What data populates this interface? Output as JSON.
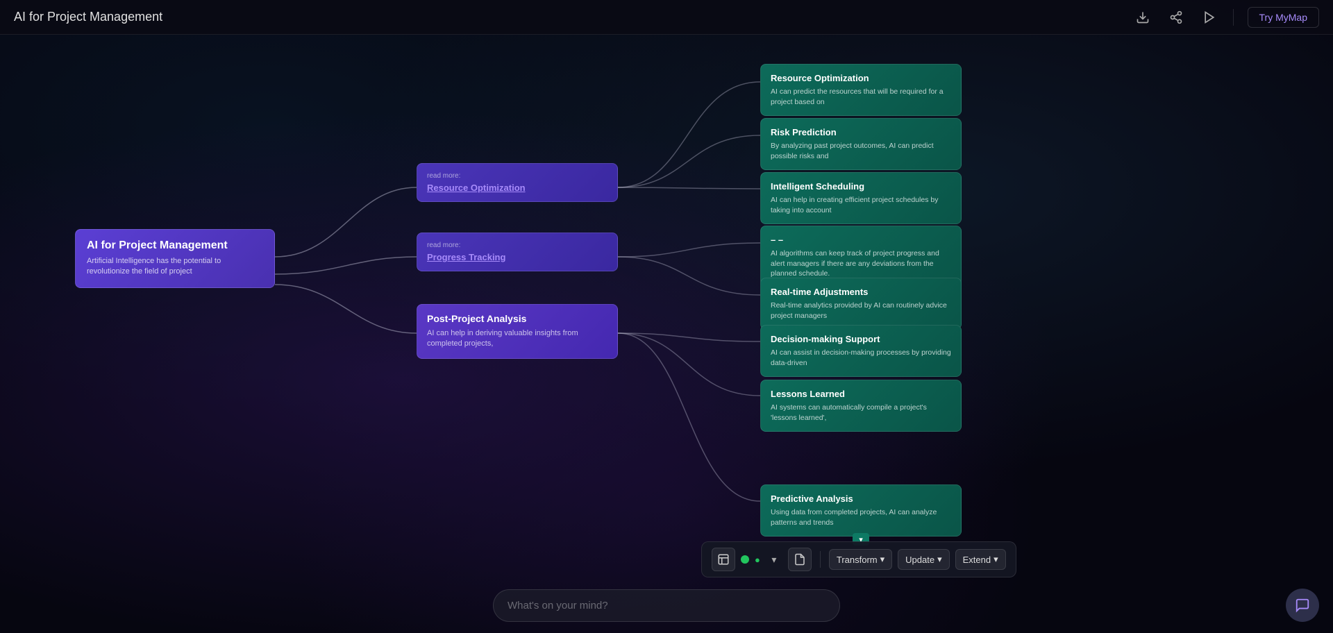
{
  "header": {
    "title": "AI for Project Management",
    "try_label": "Try MyMap"
  },
  "central_node": {
    "title": "AI for Project Management",
    "description": "Artificial Intelligence has the potential to revolutionize the field of project"
  },
  "branch_nodes": [
    {
      "id": "resource",
      "read_more": "read more:",
      "title": "Resource Optimization"
    },
    {
      "id": "progress",
      "read_more": "read more:",
      "title": "Progress Tracking"
    },
    {
      "id": "post",
      "title": "Post-Project Analysis",
      "description": "AI can help in deriving valuable insights from completed projects,"
    }
  ],
  "leaf_nodes": [
    {
      "id": "resource-opt",
      "title": "Resource Optimization",
      "description": "AI can predict the resources that will be required for a project based on"
    },
    {
      "id": "risk",
      "title": "Risk Prediction",
      "description": "By analyzing past project outcomes, AI can predict possible risks and"
    },
    {
      "id": "intelligent",
      "title": "Intelligent Scheduling",
      "description": "AI can help in creating efficient project schedules by taking into account"
    },
    {
      "id": "progress-track",
      "title": "–      –",
      "description": "AI algorithms can keep track of project progress and alert managers if there are any deviations from the planned schedule."
    },
    {
      "id": "realtime",
      "title": "Real-time Adjustments",
      "description": "Real-time analytics provided by AI can routinely advice project managers"
    },
    {
      "id": "decision",
      "title": "Decision-making Support",
      "description": "AI can assist in decision-making processes by providing data-driven"
    },
    {
      "id": "lessons",
      "title": "Lessons Learned",
      "description": "AI systems can automatically compile a project's 'lessons learned',"
    },
    {
      "id": "predictive",
      "title": "Predictive Analysis",
      "description": "Using data from completed projects, AI can analyze patterns and trends"
    }
  ],
  "toolbar": {
    "transform_label": "Transform",
    "update_label": "Update",
    "extend_label": "Extend",
    "chevron": "▾"
  },
  "chat_input": {
    "placeholder": "What's on your mind?"
  }
}
